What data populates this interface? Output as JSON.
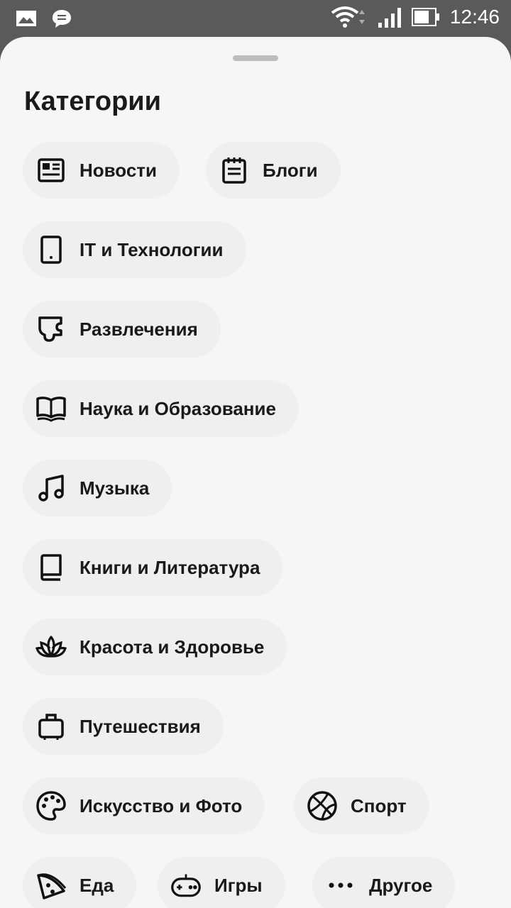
{
  "status_bar": {
    "time": "12:46",
    "icons": [
      "gallery-icon",
      "message-icon",
      "wifi-icon",
      "signal-icon",
      "battery-icon"
    ]
  },
  "sheet": {
    "title": "Категории"
  },
  "categories": [
    {
      "label": "Новости",
      "icon": "news-icon"
    },
    {
      "label": "Блоги",
      "icon": "notepad-icon"
    },
    {
      "label": "IT и Технологии",
      "icon": "tablet-icon"
    },
    {
      "label": "Развлечения",
      "icon": "puzzle-icon"
    },
    {
      "label": "Наука и Образование",
      "icon": "open-book-icon"
    },
    {
      "label": "Музыка",
      "icon": "music-note-icon"
    },
    {
      "label": "Книги и Литература",
      "icon": "book-icon"
    },
    {
      "label": "Красота и Здоровье",
      "icon": "lotus-icon"
    },
    {
      "label": "Путешествия",
      "icon": "suitcase-icon"
    },
    {
      "label": "Искусство и Фото",
      "icon": "palette-icon"
    },
    {
      "label": "Спорт",
      "icon": "basketball-icon"
    },
    {
      "label": "Еда",
      "icon": "pizza-icon"
    },
    {
      "label": "Игры",
      "icon": "gamepad-icon"
    },
    {
      "label": "Другое",
      "icon": "more-dots-icon"
    }
  ]
}
